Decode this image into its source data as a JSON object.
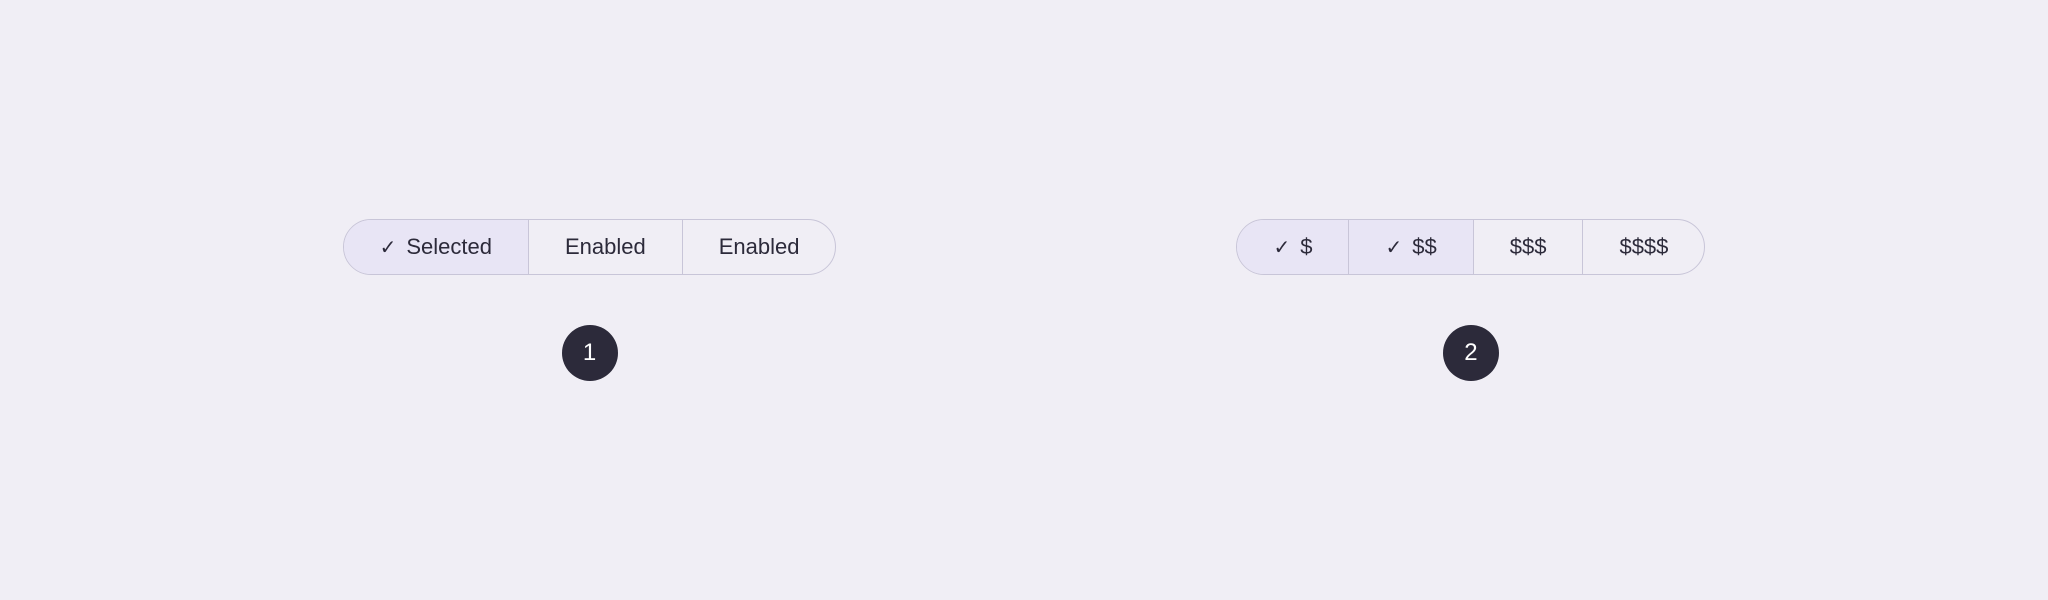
{
  "background_color": "#f0eef5",
  "example1": {
    "segments": [
      {
        "id": "selected",
        "label": "Selected",
        "has_check": true,
        "state": "selected"
      },
      {
        "id": "enabled1",
        "label": "Enabled",
        "has_check": false,
        "state": "enabled"
      },
      {
        "id": "enabled2",
        "label": "Enabled",
        "has_check": false,
        "state": "enabled"
      }
    ],
    "badge": "1"
  },
  "example2": {
    "segments": [
      {
        "id": "dollar1",
        "label": "$",
        "has_check": true,
        "state": "selected"
      },
      {
        "id": "dollar2",
        "label": "$$",
        "has_check": true,
        "state": "selected"
      },
      {
        "id": "dollar3",
        "label": "$$$",
        "has_check": false,
        "state": "enabled"
      },
      {
        "id": "dollar4",
        "label": "$$$$",
        "has_check": false,
        "state": "enabled"
      }
    ],
    "badge": "2"
  }
}
